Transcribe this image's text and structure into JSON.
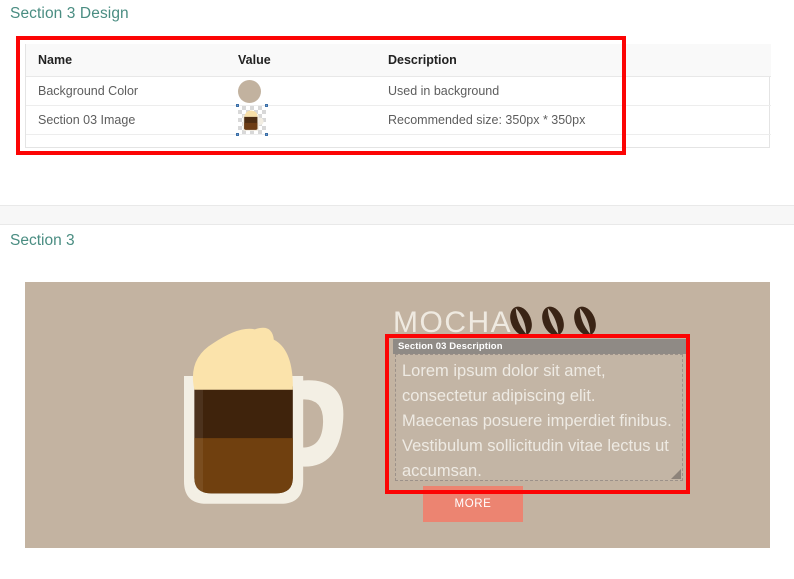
{
  "design": {
    "heading": "Section 3 Design",
    "table": {
      "columns": [
        "Name",
        "Value",
        "Description"
      ],
      "rows": [
        {
          "name": "Background Color",
          "value_type": "color-swatch",
          "value_color": "#c2b29f",
          "description": "Used in background"
        },
        {
          "name": "Section 03 Image",
          "value_type": "image-thumbnail",
          "description": "Recommended size: 350px * 350px"
        }
      ]
    }
  },
  "preview": {
    "heading": "Section 3",
    "background_color": "#c3b3a1",
    "title": "MOCHA",
    "beans_count": 3,
    "field_label": "Section 03 Description",
    "description_value": "Lorem ipsum dolor sit amet, consectetur adipiscing elit. Maecenas posuere imperdiet finibus. Vestibulum sollicitudin vitae lectus ut accumsan.",
    "description_placeholder": "Section 03 Description",
    "more_button": "MORE",
    "more_button_color": "#ec8471"
  },
  "annotations": {
    "accent_color": "#fc0404",
    "table_highlight": "design-table-highlight",
    "textarea_highlight": "description-textarea-highlight"
  }
}
